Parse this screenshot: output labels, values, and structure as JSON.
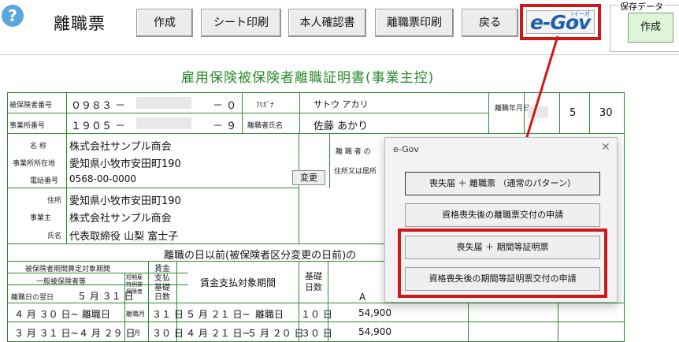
{
  "toolbar": {
    "help_glyph": "?",
    "app_title": "離職票",
    "buttons": [
      "作成",
      "シート印刷",
      "本人確認書",
      "離職票印刷",
      "戻る"
    ],
    "egov_logo": "e-Gov",
    "egov_logo_sub": "(イーガブ)",
    "save_data_label": "保存データ",
    "save_create_button": "作成"
  },
  "form": {
    "title": "雇用保険被保険者離職証明書(事業主控)",
    "insured_number_label": "被保険者番号",
    "insured_number_a": "０９８３ －",
    "insured_number_b": "－ ０",
    "furigana_label": "ﾌﾘｶﾞﾅ",
    "furigana_value": "サトウ アカリ",
    "office_number_label": "事業所番号",
    "office_number_a": "１９０５ －",
    "office_number_b": "－ ９",
    "separated_name_label": "離職者氏名",
    "separated_name_value": "佐藤 あかり",
    "separation_date_label": "離職年月日",
    "separation_month": "5",
    "separation_day": "30",
    "name_label": "名 称",
    "name_value": "株式会社サンプル商会",
    "office_address_label": "事業所所在地",
    "office_address_value": "愛知県小牧市安田町190",
    "phone_label": "電話番号",
    "phone_value": "0568-00-0000",
    "change_button": "変更",
    "separated_partial_label": "離 職 者 の",
    "address_partial_label": "住所又は居所",
    "employer_label": "事業主",
    "employer_address_label": "住所",
    "employer_address_value": "愛知県小牧市安田町190",
    "employer_company_value": "株式会社サンプル商会",
    "employer_name_label": "氏名",
    "employer_name_value": "代表取締役 山梨 富士子",
    "section_header": "離職の日以前(被保険者区分変更の日前)の",
    "period_header": "被保険者期間算定対象期間",
    "general_insured_label": "一般被保険者等",
    "short_term_label": "短期雇特例被保険者",
    "paid_days_label": "賃金支払基礎日数",
    "wage_period_label": "賃金支払対象期間",
    "base_days_label": "基礎日数",
    "col_a_label": "A",
    "day_after_label": "離職日の翌日",
    "day_after_value": "５ 月 ３１ 日",
    "rows": [
      {
        "from": "４ 月 ３０ 日~",
        "to": "離職日",
        "short": "離職月",
        "days": "３１ 日",
        "wfrom": "５ 月 ２１ 日~",
        "wto": "離職日",
        "bdays": "１０ 日",
        "amount": "54,900"
      },
      {
        "from": "３ 月 ３１ 日~",
        "to": "４ 月 ２９ 日",
        "short": "月",
        "days": "３０ 日",
        "wfrom": "４ 月 ２１ 日~",
        "wto": "５ 月 ２０ 日",
        "bdays": "３０ 日",
        "amount": "54,900"
      }
    ]
  },
  "dialog": {
    "title": "e-Gov",
    "close_glyph": "✕",
    "buttons": [
      "喪失届 ＋ 離職票 （通常のパターン）",
      "資格喪失後の離職票交付の申請",
      "喪失届 ＋ 期間等証明票",
      "資格喪失後の期間等証明票交付の申請"
    ]
  },
  "colors": {
    "accent_red": "#d01818",
    "form_green": "#2f8a2f",
    "egov_blue": "#1e5fb0"
  }
}
